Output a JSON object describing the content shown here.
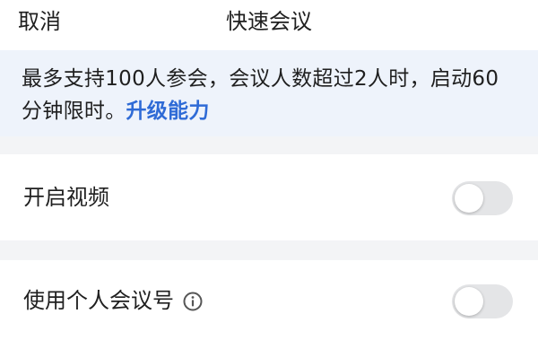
{
  "header": {
    "cancel_label": "取消",
    "title": "快速会议"
  },
  "notice": {
    "text": "最多支持100人参会，会议人数超过2人时，启动60分钟限时。",
    "upgrade_link": "升级能力"
  },
  "settings": {
    "video": {
      "label": "开启视频",
      "enabled": false
    },
    "personal_meeting_id": {
      "label": "使用个人会议号",
      "info_icon": "info-icon",
      "enabled": false
    }
  },
  "colors": {
    "link": "#2f6bd6",
    "notice_bg": "#eef3fb",
    "toggle_off": "#e4e5e7",
    "separator_bg": "#f3f4f6"
  }
}
